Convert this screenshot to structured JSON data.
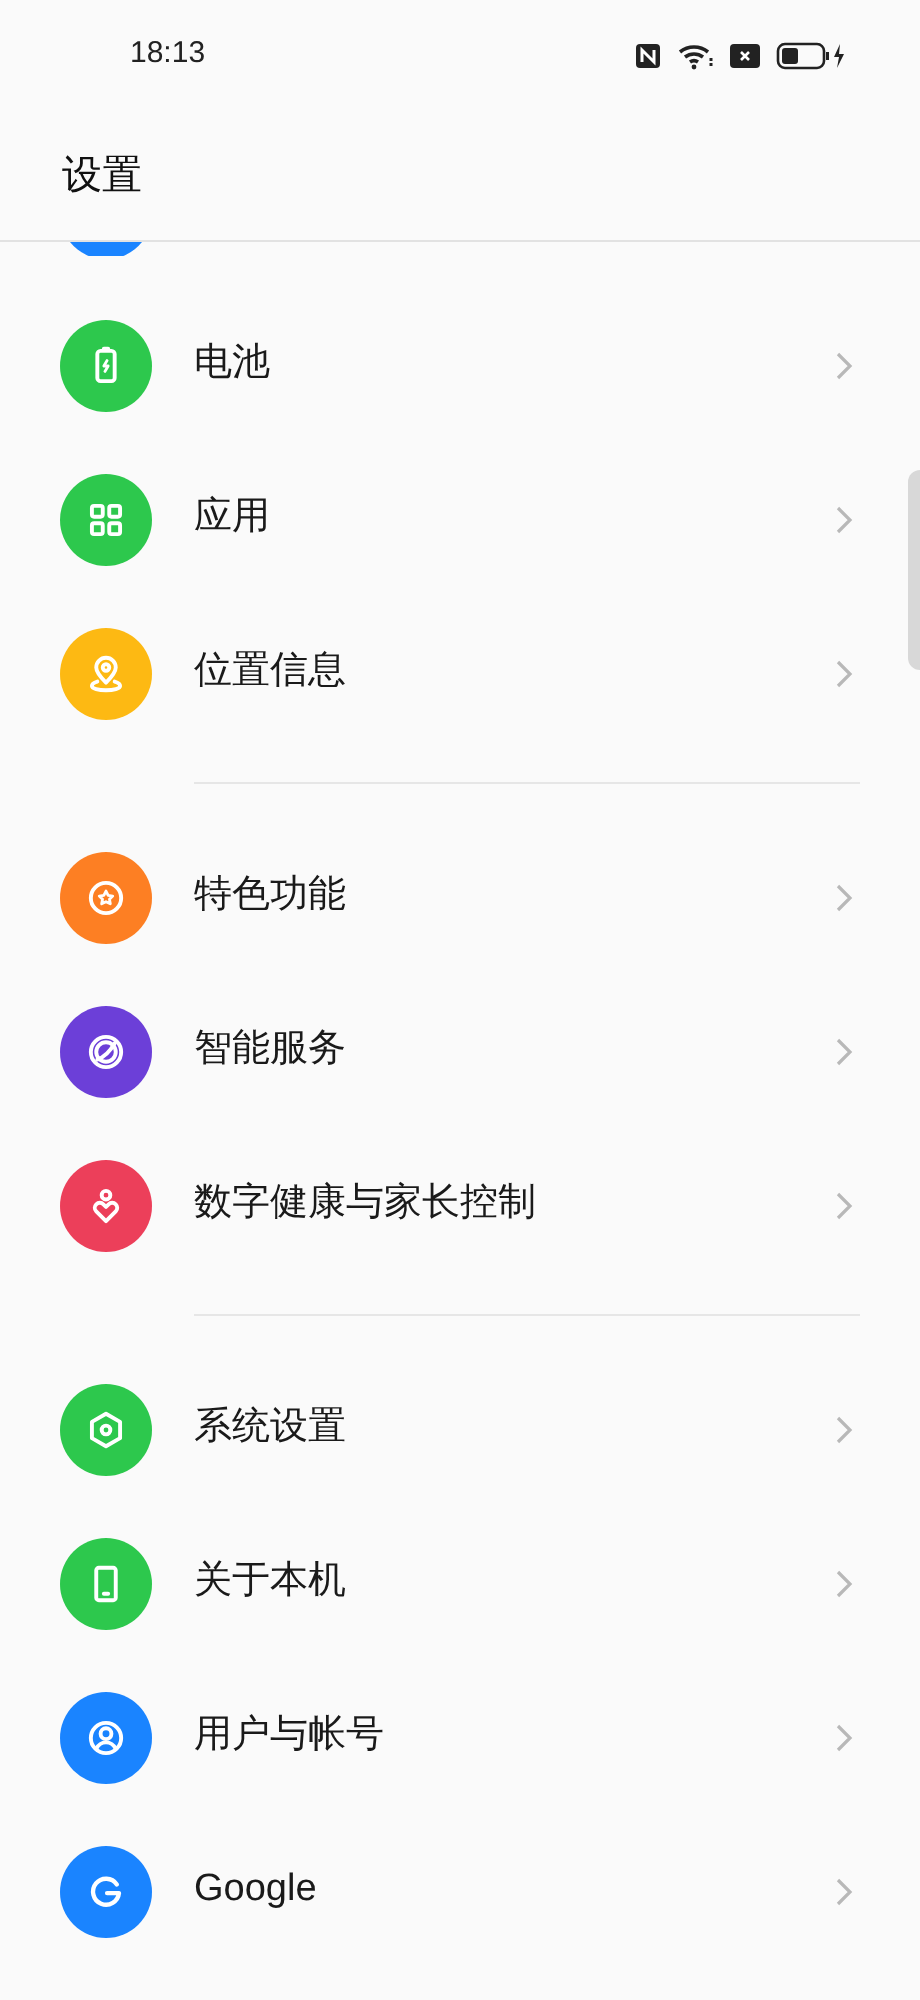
{
  "status_bar": {
    "time": "18:13"
  },
  "header": {
    "title": "设置"
  },
  "sections": [
    {
      "items": [
        {
          "label": "电池",
          "color": "#2dc84d"
        },
        {
          "label": "应用",
          "color": "#2dc84d"
        },
        {
          "label": "位置信息",
          "color": "#fdb913"
        }
      ]
    },
    {
      "items": [
        {
          "label": "特色功能",
          "color": "#fd7f23"
        },
        {
          "label": "智能服务",
          "color": "#6c3fd8"
        },
        {
          "label": "数字健康与家长控制",
          "color": "#ec3f5a"
        }
      ]
    },
    {
      "items": [
        {
          "label": "系统设置",
          "color": "#2dc84d"
        },
        {
          "label": "关于本机",
          "color": "#2dc84d"
        },
        {
          "label": "用户与帐号",
          "color": "#1a84ff"
        },
        {
          "label": "Google",
          "color": "#1a84ff"
        }
      ]
    }
  ]
}
